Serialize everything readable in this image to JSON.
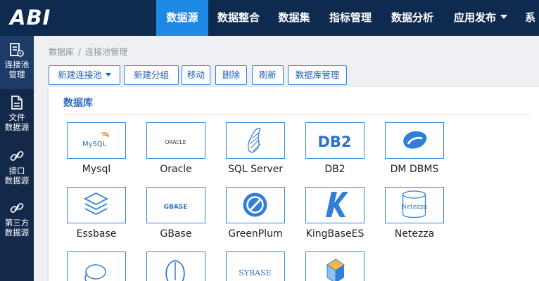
{
  "app": {
    "logo": "ABI"
  },
  "nav": [
    {
      "label": "数据源",
      "active": true
    },
    {
      "label": "数据整合"
    },
    {
      "label": "数据集"
    },
    {
      "label": "指标管理"
    },
    {
      "label": "数据分析"
    },
    {
      "label": "应用发布"
    },
    {
      "label": "系"
    }
  ],
  "sidebar": [
    {
      "label": "连接池\n管理",
      "icon": "connection-pool-icon",
      "active": true
    },
    {
      "label": "文件\n数据源",
      "icon": "file-icon"
    },
    {
      "label": "接口\n数据源",
      "icon": "link-icon"
    },
    {
      "label": "第三方\n数据源",
      "icon": "link-icon"
    }
  ],
  "breadcrumb": {
    "root": "数据库",
    "separator": "/",
    "current": "连接池管理"
  },
  "toolbar": {
    "new_pool": "新建连接池",
    "new_group": "新建分组",
    "move": "移动",
    "delete": "删除",
    "refresh": "刷新",
    "db_manage": "数据库管理"
  },
  "panel": {
    "title": "数据库",
    "databases": [
      {
        "name": "Mysql",
        "logo_text": "MySQL",
        "icon": "mysql-logo-icon"
      },
      {
        "name": "Oracle",
        "logo_text": "ORACLE",
        "icon": "oracle-logo-icon"
      },
      {
        "name": "SQL Server",
        "logo_text": "",
        "icon": "sql-server-logo-icon"
      },
      {
        "name": "DB2",
        "logo_text": "DB2",
        "icon": "db2-logo-icon"
      },
      {
        "name": "DM DBMS",
        "logo_text": "",
        "icon": "dm-dbms-logo-icon"
      },
      {
        "name": "Essbase",
        "logo_text": "",
        "icon": "essbase-logo-icon"
      },
      {
        "name": "GBase",
        "logo_text": "GBASE",
        "icon": "gbase-logo-icon"
      },
      {
        "name": "GreenPlum",
        "logo_text": "",
        "icon": "greenplum-logo-icon"
      },
      {
        "name": "KingBaseES",
        "logo_text": "",
        "icon": "kingbase-logo-icon"
      },
      {
        "name": "Netezza",
        "logo_text": "Netezza",
        "icon": "netezza-logo-icon"
      },
      {
        "name": "",
        "logo_text": "",
        "icon": "hadoop-elephant-logo-icon"
      },
      {
        "name": "",
        "logo_text": "",
        "icon": "postgresql-elephant-logo-icon"
      },
      {
        "name": "",
        "logo_text": "SYBASE",
        "icon": "sybase-logo-icon"
      },
      {
        "name": "",
        "logo_text": "",
        "icon": "cube-logo-icon"
      }
    ]
  },
  "colors": {
    "topbar": "#0f2a4f",
    "accent": "#1e88e5",
    "sidebar": "#12294a",
    "card_border": "#2f86e0",
    "title_blue": "#2d6cc0"
  }
}
